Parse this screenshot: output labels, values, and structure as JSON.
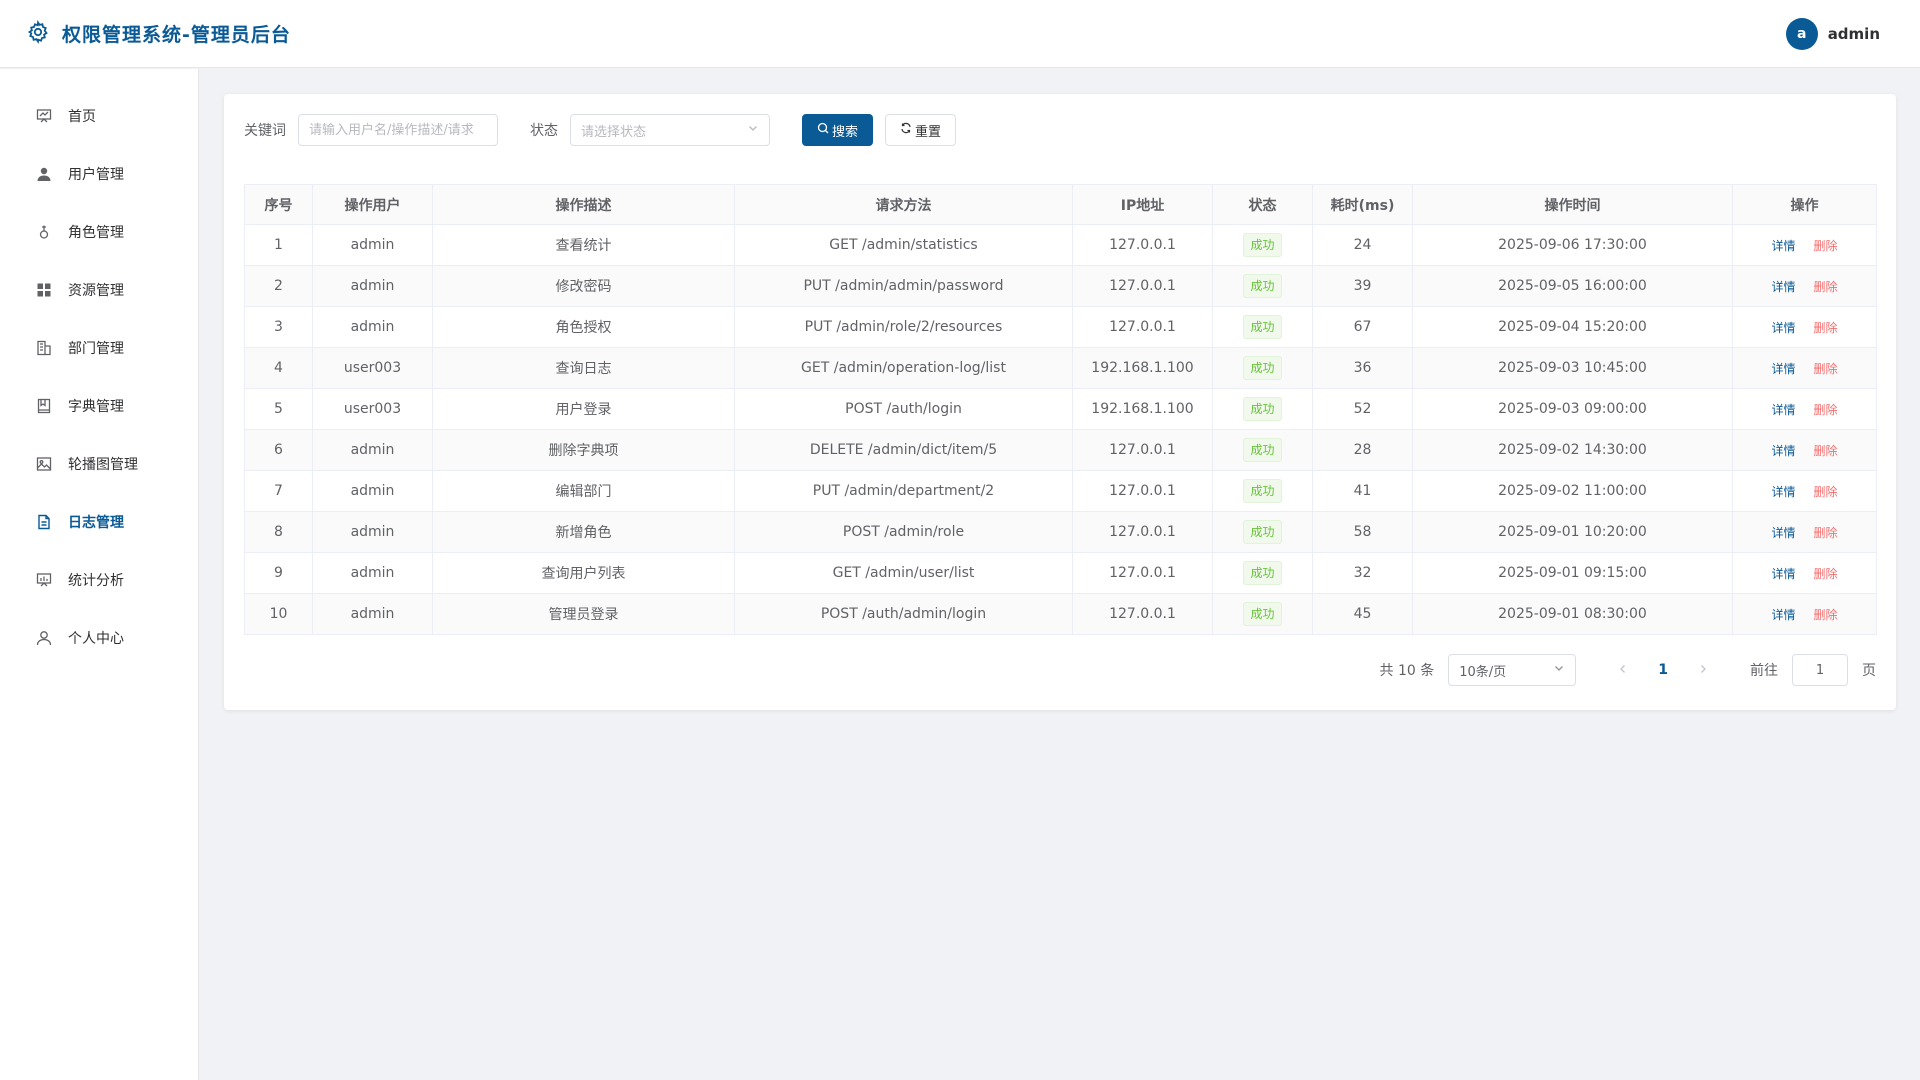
{
  "app": {
    "title": "权限管理系统-管理员后台",
    "user": {
      "initial": "a",
      "name": "admin"
    }
  },
  "sidebar": {
    "items": [
      {
        "label": "首页",
        "icon": "dashboard-icon",
        "active": false
      },
      {
        "label": "用户管理",
        "icon": "user-icon",
        "active": false
      },
      {
        "label": "角色管理",
        "icon": "role-icon",
        "active": false
      },
      {
        "label": "资源管理",
        "icon": "grid-icon",
        "active": false
      },
      {
        "label": "部门管理",
        "icon": "building-icon",
        "active": false
      },
      {
        "label": "字典管理",
        "icon": "book-icon",
        "active": false
      },
      {
        "label": "轮播图管理",
        "icon": "picture-icon",
        "active": false
      },
      {
        "label": "日志管理",
        "icon": "document-icon",
        "active": true
      },
      {
        "label": "统计分析",
        "icon": "chart-icon",
        "active": false
      },
      {
        "label": "个人中心",
        "icon": "person-icon",
        "active": false
      }
    ]
  },
  "filters": {
    "keyword_label": "关键词",
    "keyword_placeholder": "请输入用户名/操作描述/请求",
    "status_label": "状态",
    "status_placeholder": "请选择状态",
    "search_label": "搜索",
    "reset_label": "重置"
  },
  "table": {
    "headers": [
      "序号",
      "操作用户",
      "操作描述",
      "请求方法",
      "IP地址",
      "状态",
      "耗时(ms)",
      "操作时间",
      "操作"
    ],
    "actions": {
      "detail": "详情",
      "delete": "删除"
    },
    "rows": [
      {
        "no": "1",
        "user": "admin",
        "desc": "查看统计",
        "method": "GET /admin/statistics",
        "ip": "127.0.0.1",
        "status": "成功",
        "cost": "24",
        "time": "2025-09-06 17:30:00"
      },
      {
        "no": "2",
        "user": "admin",
        "desc": "修改密码",
        "method": "PUT /admin/admin/password",
        "ip": "127.0.0.1",
        "status": "成功",
        "cost": "39",
        "time": "2025-09-05 16:00:00"
      },
      {
        "no": "3",
        "user": "admin",
        "desc": "角色授权",
        "method": "PUT /admin/role/2/resources",
        "ip": "127.0.0.1",
        "status": "成功",
        "cost": "67",
        "time": "2025-09-04 15:20:00"
      },
      {
        "no": "4",
        "user": "user003",
        "desc": "查询日志",
        "method": "GET /admin/operation-log/list",
        "ip": "192.168.1.100",
        "status": "成功",
        "cost": "36",
        "time": "2025-09-03 10:45:00"
      },
      {
        "no": "5",
        "user": "user003",
        "desc": "用户登录",
        "method": "POST /auth/login",
        "ip": "192.168.1.100",
        "status": "成功",
        "cost": "52",
        "time": "2025-09-03 09:00:00"
      },
      {
        "no": "6",
        "user": "admin",
        "desc": "删除字典项",
        "method": "DELETE /admin/dict/item/5",
        "ip": "127.0.0.1",
        "status": "成功",
        "cost": "28",
        "time": "2025-09-02 14:30:00"
      },
      {
        "no": "7",
        "user": "admin",
        "desc": "编辑部门",
        "method": "PUT /admin/department/2",
        "ip": "127.0.0.1",
        "status": "成功",
        "cost": "41",
        "time": "2025-09-02 11:00:00"
      },
      {
        "no": "8",
        "user": "admin",
        "desc": "新增角色",
        "method": "POST /admin/role",
        "ip": "127.0.0.1",
        "status": "成功",
        "cost": "58",
        "time": "2025-09-01 10:20:00"
      },
      {
        "no": "9",
        "user": "admin",
        "desc": "查询用户列表",
        "method": "GET /admin/user/list",
        "ip": "127.0.0.1",
        "status": "成功",
        "cost": "32",
        "time": "2025-09-01 09:15:00"
      },
      {
        "no": "10",
        "user": "admin",
        "desc": "管理员登录",
        "method": "POST /auth/admin/login",
        "ip": "127.0.0.1",
        "status": "成功",
        "cost": "45",
        "time": "2025-09-01 08:30:00"
      }
    ]
  },
  "pagination": {
    "total_text": "共 10 条",
    "page_size": "10条/页",
    "current_page": "1",
    "goto_label": "前往",
    "goto_value": "1",
    "page_unit": "页"
  },
  "colors": {
    "primary": "#0a5a96",
    "success": "#67c23a",
    "danger": "#f56c6c"
  }
}
